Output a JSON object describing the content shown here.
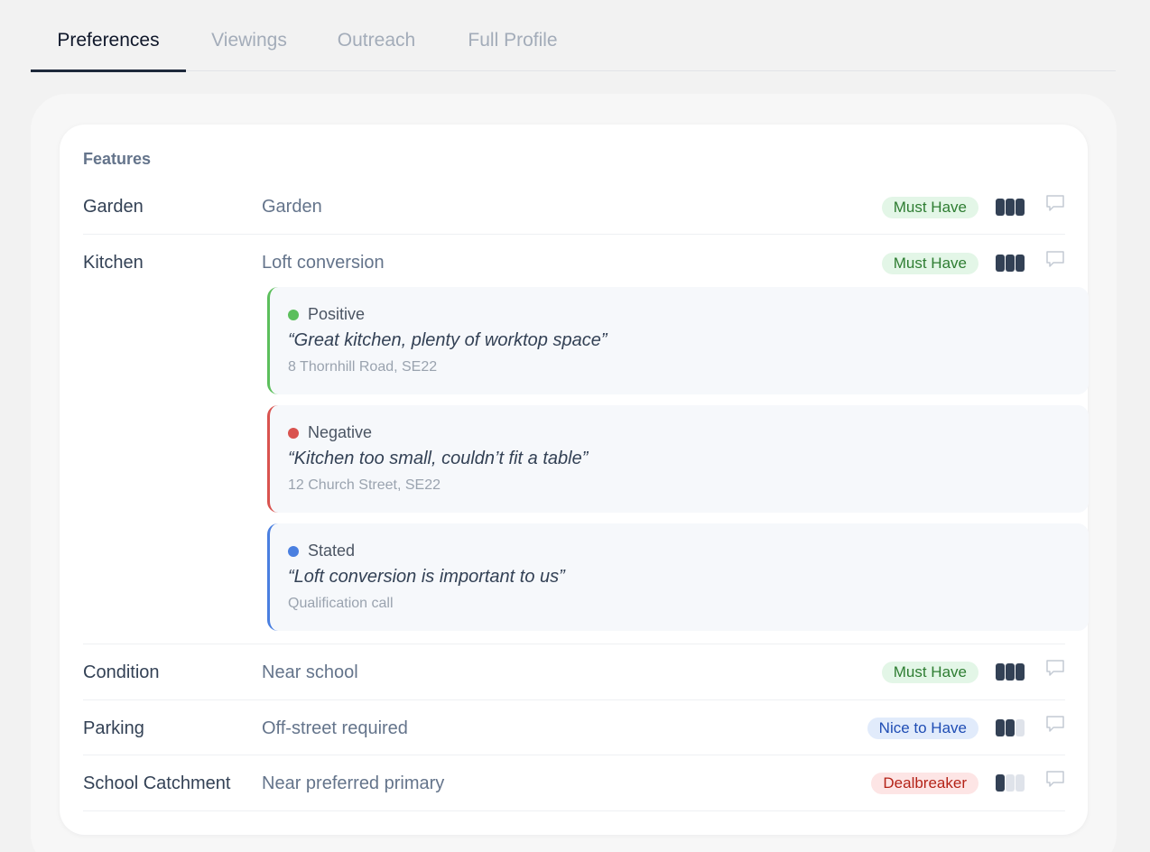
{
  "tabs": [
    {
      "label": "Preferences",
      "active": true
    },
    {
      "label": "Viewings",
      "active": false
    },
    {
      "label": "Outreach",
      "active": false
    },
    {
      "label": "Full Profile",
      "active": false
    }
  ],
  "section_title": "Features",
  "rows": [
    {
      "label": "Garden",
      "value": "Garden",
      "priority": "Must Have",
      "strength": 3
    },
    {
      "label": "Kitchen",
      "value": "Loft conversion",
      "priority": "Must Have",
      "strength": 3
    },
    {
      "label": "Condition",
      "value": "Near school",
      "priority": "Must Have",
      "strength": 3
    },
    {
      "label": "Parking",
      "value": "Off-street required",
      "priority": "Nice to Have",
      "strength": 2
    },
    {
      "label": "School Catchment",
      "value": "Near preferred primary",
      "priority": "Dealbreaker",
      "strength": 1
    }
  ],
  "evidence": [
    {
      "type": "Positive",
      "quote": "“Great kitchen, plenty of worktop space”",
      "source": "8 Thornhill Road, SE22",
      "color": "#5cbf5c"
    },
    {
      "type": "Negative",
      "quote": "“Kitchen too small, couldn’t fit a table”",
      "source": "12 Church Street, SE22",
      "color": "#d9534f"
    },
    {
      "type": "Stated",
      "quote": "“Loft conversion is important to us”",
      "source": "Qualification call",
      "color": "#4a7fe0"
    }
  ],
  "icons": {
    "comment": "comment-icon"
  }
}
